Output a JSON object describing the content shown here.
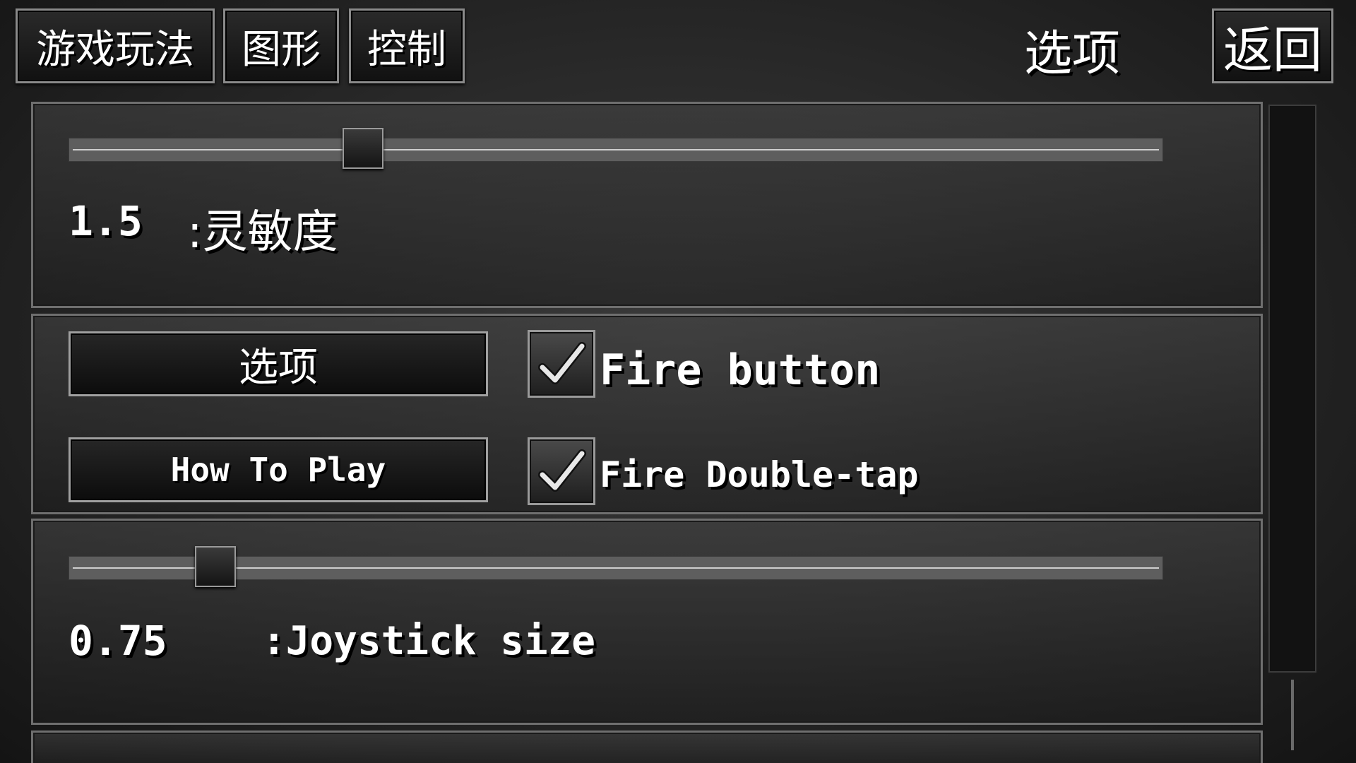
{
  "tabs": [
    {
      "label": "游戏玩法"
    },
    {
      "label": "图形"
    },
    {
      "label": "控制"
    }
  ],
  "header": {
    "title": "选项",
    "back_label": "返回"
  },
  "sensitivity": {
    "value": "1.5",
    "label": ":灵敏度",
    "slider_fraction": 0.26
  },
  "buttons": {
    "options_label": "选项",
    "how_to_play_label": "How To Play"
  },
  "checkboxes": [
    {
      "label": "Fire button",
      "checked": true
    },
    {
      "label": "Fire Double-tap",
      "checked": true
    }
  ],
  "joystick": {
    "value": "0.75",
    "label": ":Joystick size",
    "slider_fraction": 0.12
  },
  "colors": {
    "background": "#2a2a2a",
    "text": "#ffffff",
    "border": "#8a8a8a"
  }
}
